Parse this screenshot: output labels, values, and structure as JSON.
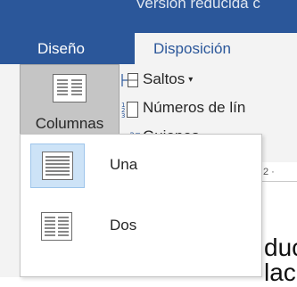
{
  "title_bar": {
    "title": "Versión reducida c"
  },
  "tabs": [
    {
      "label": "Diseño",
      "active": false
    },
    {
      "label": "Disposición",
      "active": true
    }
  ],
  "ribbon": {
    "columns_button": {
      "label": "Columnas",
      "icon": "columns-icon"
    },
    "commands": [
      {
        "label": "Saltos",
        "icon": "page-breaks-icon",
        "has_dropdown": true
      },
      {
        "label": "Números de lín",
        "icon": "line-numbers-icon",
        "has_dropdown": false
      },
      {
        "label": "Guiones",
        "icon": "hyphenation-icon",
        "has_dropdown": true
      }
    ]
  },
  "columns_menu": {
    "items": [
      {
        "label": "Una",
        "icon": "one-column-icon",
        "selected": true
      },
      {
        "label": "Dos",
        "icon": "two-columns-icon",
        "selected": false
      }
    ]
  },
  "document": {
    "ruler_fragment": "2 ·",
    "text_lines": [
      "duc",
      "lac"
    ]
  },
  "colors": {
    "title_bar": "#2b579a",
    "ribbon_bg": "#f3f3f3",
    "active_tab_text": "#2b579a",
    "selected_item_bg": "#cde3f7"
  }
}
